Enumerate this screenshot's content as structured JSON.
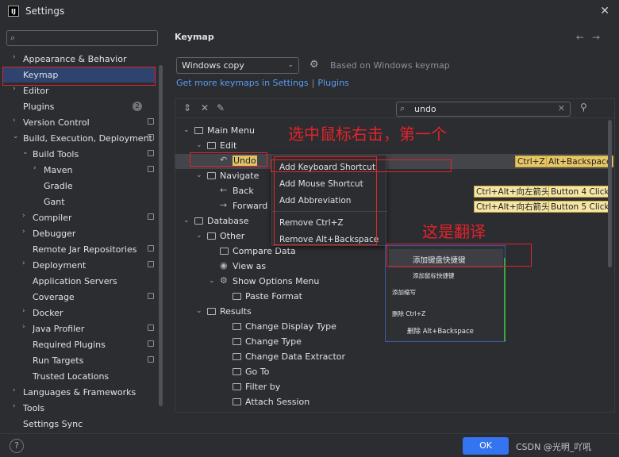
{
  "window": {
    "title": "Settings",
    "logo": "IJ"
  },
  "left_nav": {
    "search_placeholder": "",
    "items": [
      {
        "label": "Appearance & Behavior",
        "arrow": "›"
      },
      {
        "label": "Keymap",
        "arrow": ""
      },
      {
        "label": "Editor",
        "arrow": "›"
      },
      {
        "label": "Plugins",
        "arrow": "",
        "badge": "2"
      },
      {
        "label": "Version Control",
        "arrow": "›"
      },
      {
        "label": "Build, Execution, Deployment",
        "arrow": "⌄"
      },
      {
        "label": "Build Tools",
        "arrow": "⌄"
      },
      {
        "label": "Maven",
        "arrow": "›"
      },
      {
        "label": "Gradle",
        "arrow": ""
      },
      {
        "label": "Gant",
        "arrow": ""
      },
      {
        "label": "Compiler",
        "arrow": "›"
      },
      {
        "label": "Debugger",
        "arrow": "›"
      },
      {
        "label": "Remote Jar Repositories",
        "arrow": ""
      },
      {
        "label": "Deployment",
        "arrow": "›"
      },
      {
        "label": "Application Servers",
        "arrow": ""
      },
      {
        "label": "Coverage",
        "arrow": ""
      },
      {
        "label": "Docker",
        "arrow": "›"
      },
      {
        "label": "Java Profiler",
        "arrow": "›"
      },
      {
        "label": "Required Plugins",
        "arrow": ""
      },
      {
        "label": "Run Targets",
        "arrow": ""
      },
      {
        "label": "Trusted Locations",
        "arrow": ""
      },
      {
        "label": "Languages & Frameworks",
        "arrow": "›"
      },
      {
        "label": "Tools",
        "arrow": "›"
      },
      {
        "label": "Settings Sync",
        "arrow": ""
      }
    ]
  },
  "main": {
    "title": "Keymap",
    "nav_back": "←",
    "nav_forward": "→",
    "keymap_select": "Windows copy",
    "based_on": "Based on Windows keymap",
    "link_get_more": "Get more keymaps in Settings",
    "link_sep": "|",
    "link_plugins": "Plugins",
    "filter_value": "undo",
    "tree": {
      "main_menu": "Main Menu",
      "edit": "Edit",
      "undo": "Undo",
      "undo_sc1": "Ctrl+Z",
      "undo_sc2": "Alt+Backspace",
      "navigate": "Navigate",
      "back": "Back",
      "back_sc1": "Ctrl+Alt+向左箭头",
      "back_sc2": "Button 4 Click",
      "forward": "Forward",
      "fwd_sc1": "Ctrl+Alt+向右箭头",
      "fwd_sc2": "Button 5 Click",
      "database": "Database",
      "other": "Other",
      "compare_data": "Compare Data",
      "view_as": "View as",
      "show_options_menu": "Show Options Menu",
      "paste_format": "Paste Format",
      "results": "Results",
      "change_display_type": "Change Display Type",
      "change_type": "Change Type",
      "change_data_extractor": "Change Data Extractor",
      "go_to": "Go To",
      "filter_by": "Filter by",
      "attach_session": "Attach Session"
    }
  },
  "context_menu": {
    "add_keyboard": "Add Keyboard Shortcut",
    "add_mouse": "Add Mouse Shortcut",
    "add_abbrev": "Add Abbreviation",
    "remove_ctrlz": "Remove Ctrl+Z",
    "remove_alt": "Remove Alt+Backspace"
  },
  "annotations": {
    "top": "选中鼠标右击，第一个",
    "translation_label": "这是翻译"
  },
  "translation_popup": {
    "add_keyboard": "添加键盘快捷键",
    "add_mouse": "添加鼠标快捷键",
    "add_abbrev": "添加缩写",
    "remove_ctrlz": "删除 Ctrl+Z",
    "remove_alt": "删除 Alt+Backspace"
  },
  "footer": {
    "help": "?",
    "ok": "OK",
    "watermark": "CSDN @光明_吖吼"
  },
  "colors": {
    "accent": "#3574f0",
    "highlight": "#e0c367",
    "annotation_red": "#e0262b",
    "selected_nav": "#2e436e"
  }
}
